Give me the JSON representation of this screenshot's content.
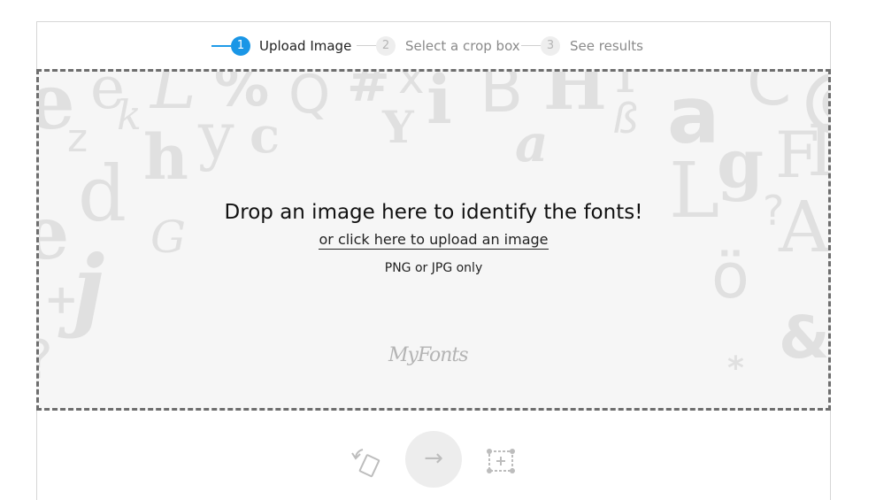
{
  "steps": [
    {
      "number": "1",
      "label": "Upload Image",
      "active": true
    },
    {
      "number": "2",
      "label": "Select a crop box",
      "active": false
    },
    {
      "number": "3",
      "label": "See results",
      "active": false
    }
  ],
  "dropzone": {
    "title": "Drop an image here to identify the fonts!",
    "upload_link": "or click here to upload an image",
    "formats": "PNG or JPG only",
    "logo_text": "MyFonts"
  },
  "toolbar": {
    "rotate_icon": "rotate-icon",
    "next_icon": "arrow-right-icon",
    "next_symbol": "→",
    "crop_icon": "crop-box-icon"
  },
  "colors": {
    "accent": "#1a96e6",
    "border": "#6e6e6e",
    "dropzone_bg": "#f6f6f6",
    "glyph": "#e0e0e0"
  }
}
